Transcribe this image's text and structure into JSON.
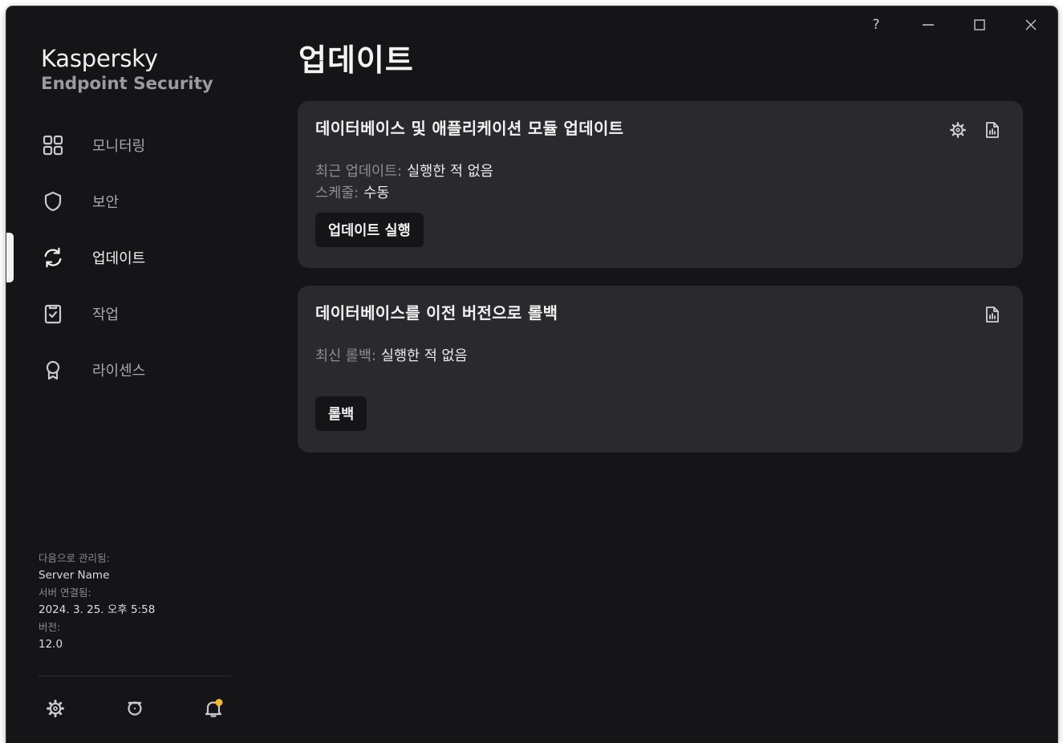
{
  "brand": {
    "name": "Kaspersky",
    "product": "Endpoint Security"
  },
  "nav": [
    {
      "label": "모니터링",
      "icon": "dashboard-grid-icon"
    },
    {
      "label": "보안",
      "icon": "shield-icon"
    },
    {
      "label": "업데이트",
      "icon": "refresh-icon",
      "active": true
    },
    {
      "label": "작업",
      "icon": "clipboard-check-icon"
    },
    {
      "label": "라이센스",
      "icon": "award-ribbon-icon"
    }
  ],
  "managed": {
    "managed_by_label": "다음으로 관리됨:",
    "server_name": "Server Name",
    "connected_label": "서버 연결됨:",
    "connected_time": "2024. 3. 25. 오후 5:58",
    "version_label": "버전:",
    "version": "12.0"
  },
  "window": {
    "help": "?"
  },
  "page": {
    "title": "업데이트"
  },
  "cards": {
    "update": {
      "title": "데이터베이스 및 애플리케이션 모듈 업데이트",
      "last_update_label": "최근 업데이트:",
      "last_update_value": "실행한 적 없음",
      "schedule_label": "스케줄:",
      "schedule_value": "수동",
      "button": "업데이트 실행"
    },
    "rollback": {
      "title": "데이터베이스를 이전 버전으로 롤백",
      "last_rollback_label": "최신 롤백:",
      "last_rollback_value": "실행한 적 없음",
      "button": "롤백"
    }
  },
  "colors": {
    "background": "#151518",
    "card": "#2a2a2e",
    "text": "#f2f2f2",
    "muted": "#8d8d93",
    "notification_dot": "#f5b731"
  }
}
